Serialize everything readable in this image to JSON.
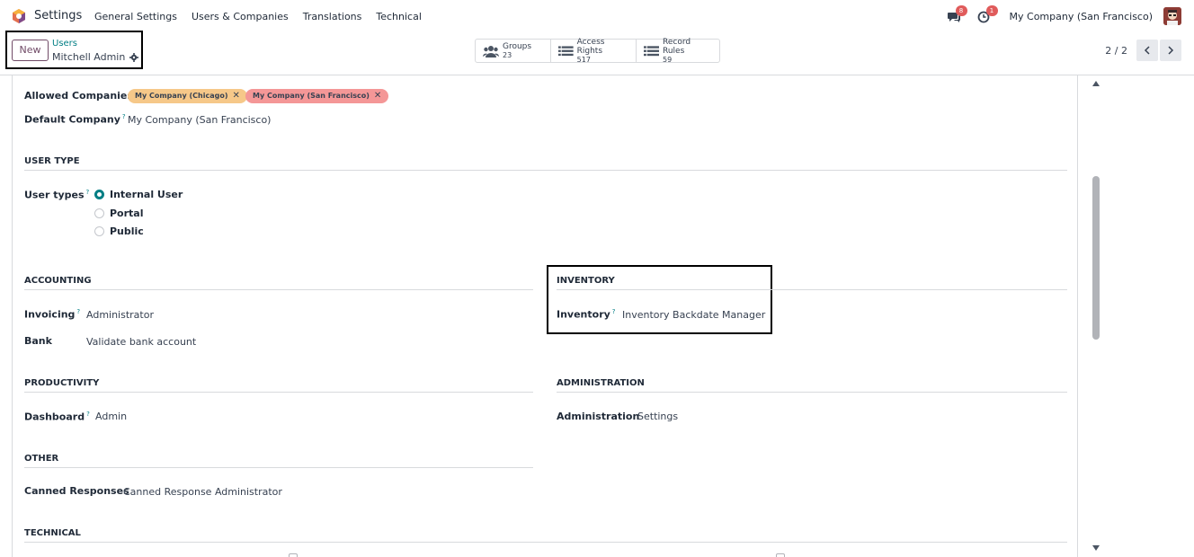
{
  "navbar": {
    "app_name": "Settings",
    "menu": [
      "General Settings",
      "Users & Companies",
      "Translations",
      "Technical"
    ],
    "messages_count": "8",
    "activities_count": "1",
    "company": "My Company (San Francisco)"
  },
  "control": {
    "new_label": "New",
    "breadcrumb": "Users",
    "record_name": "Mitchell Admin",
    "smart_buttons": [
      {
        "label": "Groups",
        "value": "23"
      },
      {
        "label": "Access Rights",
        "value": "517"
      },
      {
        "label": "Record Rules",
        "value": "59"
      }
    ],
    "pager": "2 / 2"
  },
  "form": {
    "allowed_companies_label": "Allowed Companies",
    "allowed_companies": [
      "My Company (Chicago)",
      "My Company (San Francisco)"
    ],
    "default_company_label": "Default Company",
    "default_company": "My Company (San Francisco)",
    "user_type_title": "USER TYPE",
    "user_types_label": "User types",
    "user_types": [
      "Internal User",
      "Portal",
      "Public"
    ],
    "accounting_title": "ACCOUNTING",
    "invoicing_label": "Invoicing",
    "invoicing_value": "Administrator",
    "bank_label": "Bank",
    "bank_value": "Validate bank account",
    "inventory_title": "INVENTORY",
    "inventory_label": "Inventory",
    "inventory_value": "Inventory Backdate Manager",
    "productivity_title": "PRODUCTIVITY",
    "dashboard_label": "Dashboard",
    "dashboard_value": "Admin",
    "administration_title": "ADMINISTRATION",
    "administration_label": "Administration",
    "administration_value": "Settings",
    "other_title": "OTHER",
    "canned_label": "Canned Responses",
    "canned_value": "Canned Response Administrator",
    "technical_title": "TECHNICAL",
    "help_mark": "?"
  },
  "colors": {
    "brand": "#714b67",
    "accent": "#017e84",
    "tag_chicago": "#f6c889",
    "tag_sf": "#f49797"
  }
}
